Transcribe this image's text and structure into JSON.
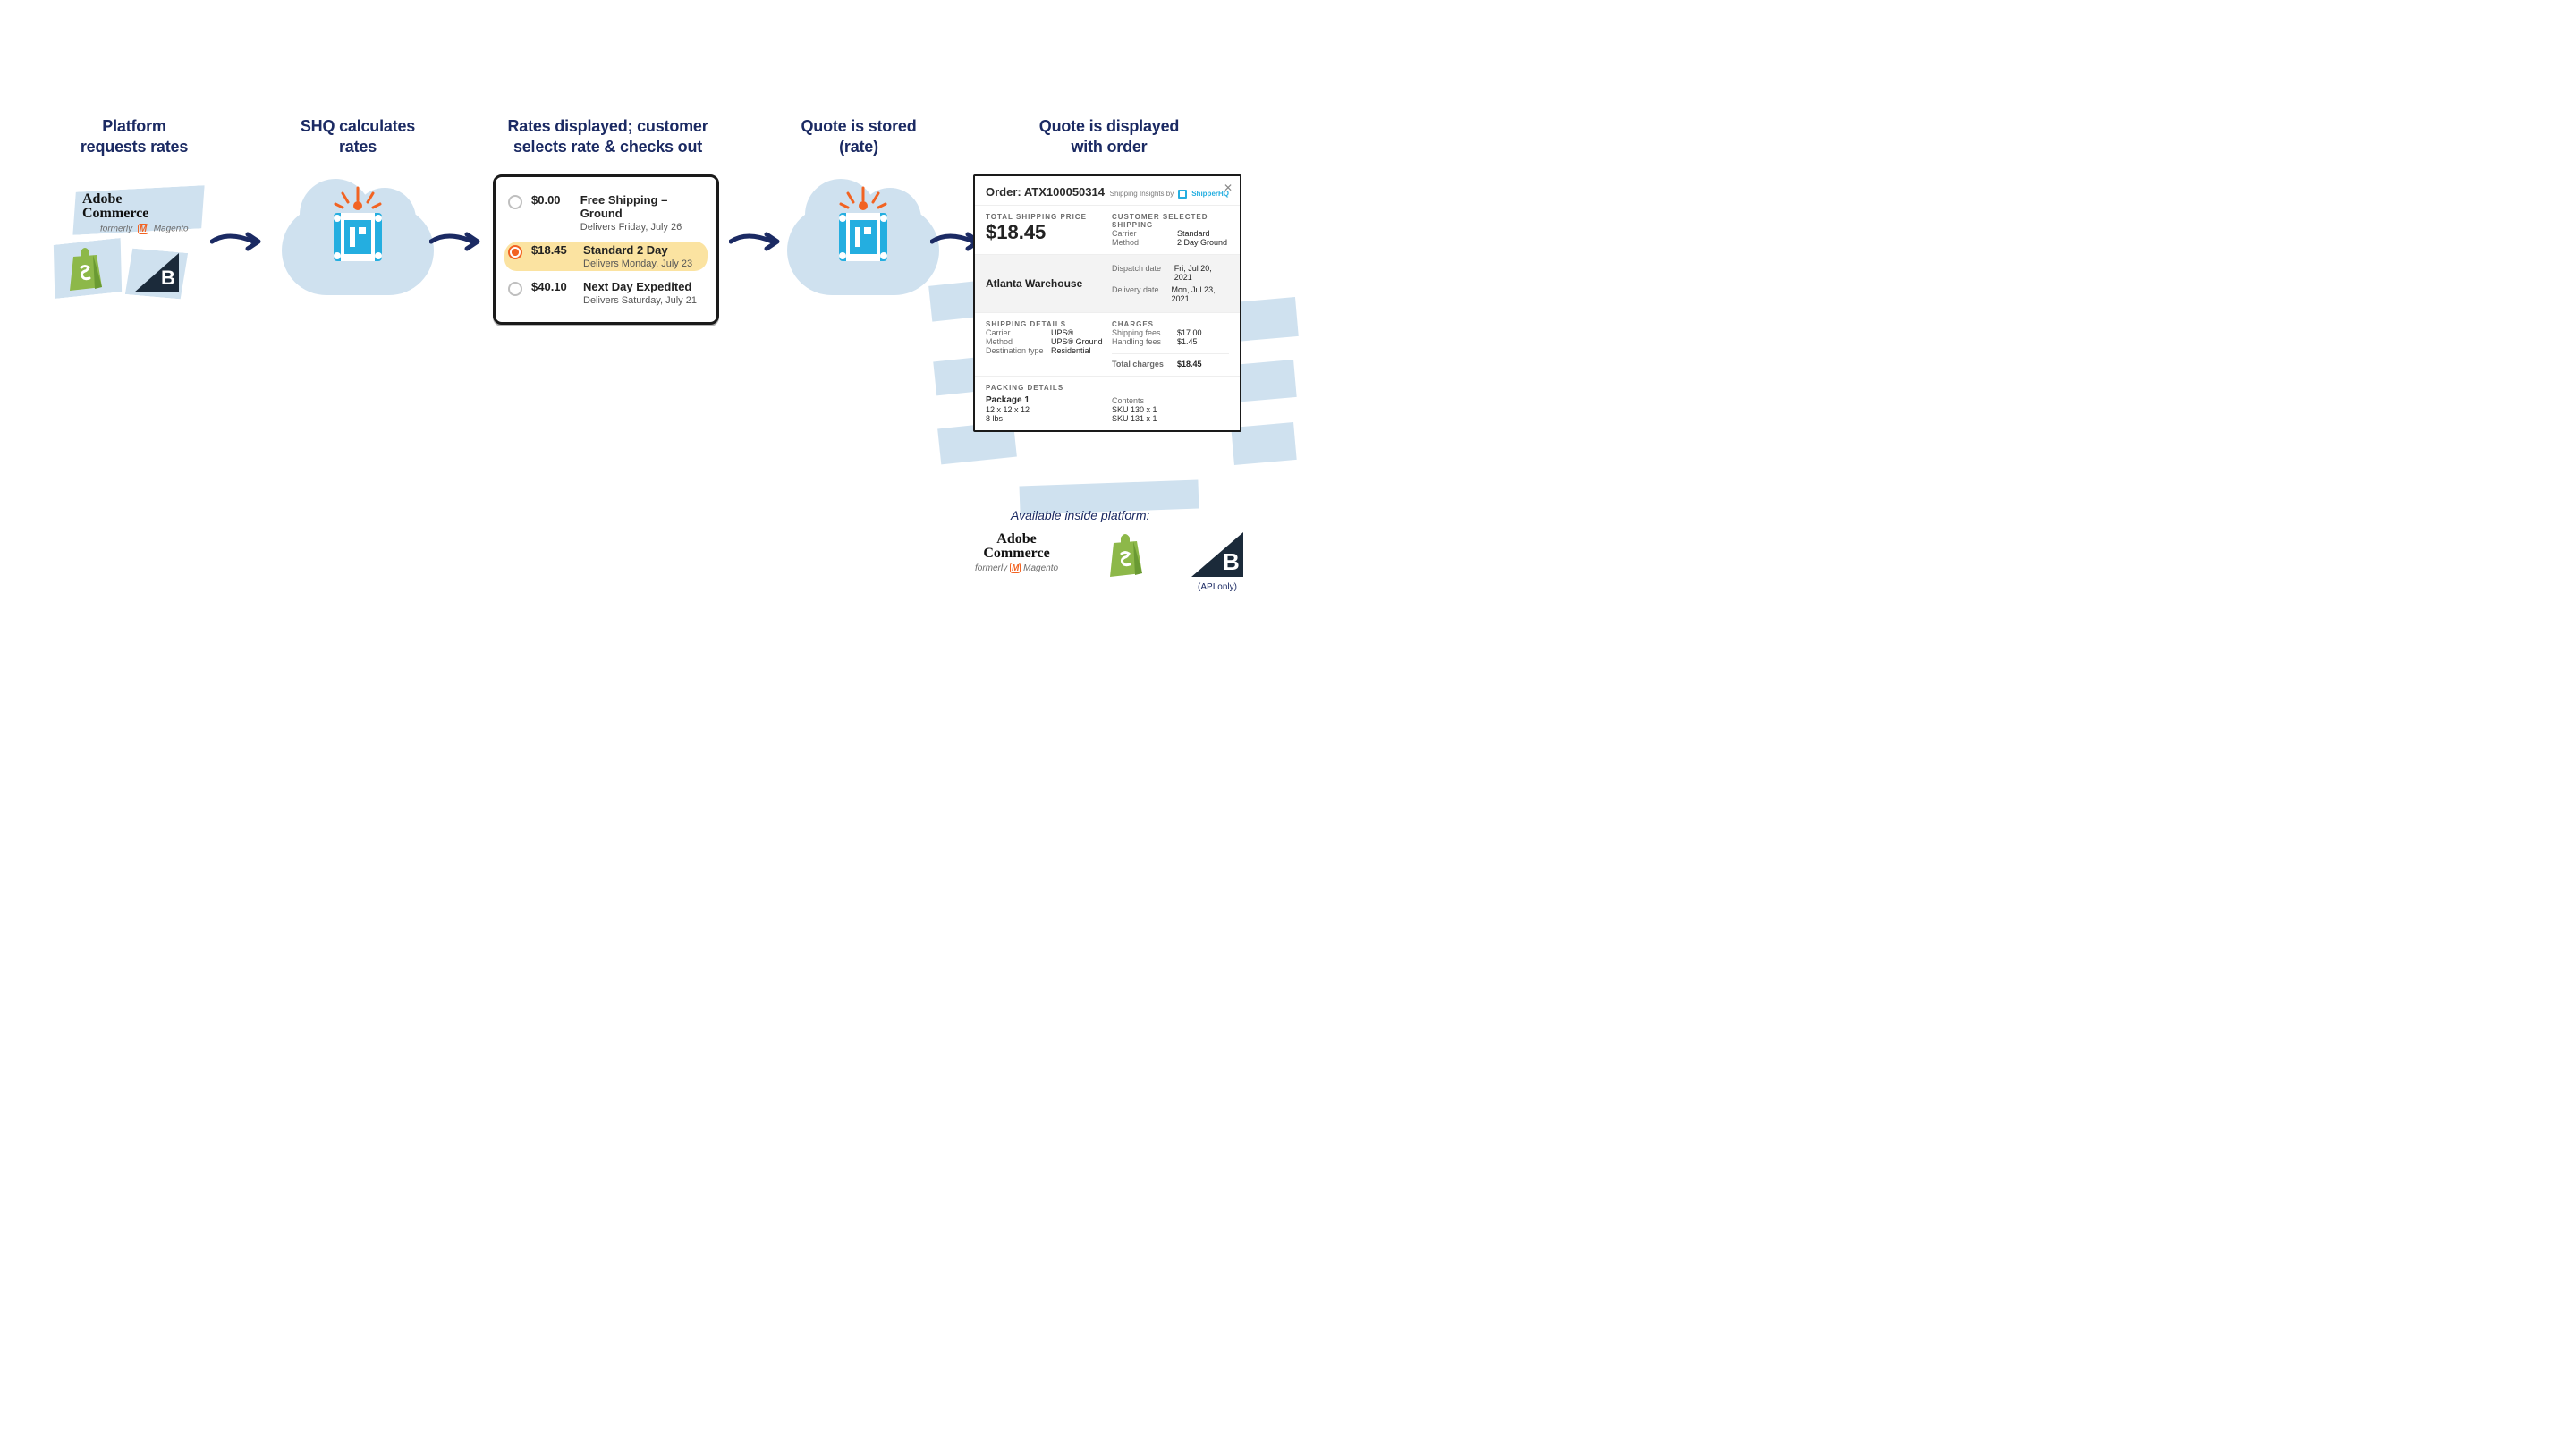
{
  "steps": {
    "s1": "Platform\nrequests rates",
    "s2": "SHQ calculates\nrates",
    "s3": "Rates displayed; customer\nselects rate & checks out",
    "s4": "Quote is stored\n(rate)",
    "s5": "Quote is displayed\nwith order"
  },
  "platforms": {
    "adobe_line1": "Adobe",
    "adobe_line2": "Commerce",
    "formerly": "formerly",
    "magento": "Magento"
  },
  "rates": [
    {
      "price": "$0.00",
      "name": "Free Shipping – Ground",
      "sub": "Delivers Friday, July 26",
      "selected": false
    },
    {
      "price": "$18.45",
      "name": "Standard 2 Day",
      "sub": "Delivers Monday, July 23",
      "selected": true
    },
    {
      "price": "$40.10",
      "name": "Next Day Expedited",
      "sub": "Delivers Saturday, July 21",
      "selected": false
    }
  ],
  "order": {
    "title": "Order: ATX100050314",
    "insights_by": "Shipping Insights by",
    "brand": "ShipperHQ",
    "total_label": "TOTAL SHIPPING PRICE",
    "total_value": "$18.45",
    "sel_label": "CUSTOMER SELECTED SHIPPING",
    "sel_carrier_k": "Carrier",
    "sel_carrier_v": "Standard",
    "sel_method_k": "Method",
    "sel_method_v": "2 Day Ground",
    "warehouse": "Atlanta Warehouse",
    "dispatch_k": "Dispatch date",
    "dispatch_v": "Fri, Jul 20, 2021",
    "delivery_k": "Delivery date",
    "delivery_v": "Mon, Jul 23, 2021",
    "ship_details_label": "SHIPPING DETAILS",
    "ship_carrier_k": "Carrier",
    "ship_carrier_v": "UPS®",
    "ship_method_k": "Method",
    "ship_method_v": "UPS® Ground",
    "ship_dest_k": "Destination type",
    "ship_dest_v": "Residential",
    "charges_label": "CHARGES",
    "charge_ship_k": "Shipping fees",
    "charge_ship_v": "$17.00",
    "charge_hand_k": "Handling fees",
    "charge_hand_v": "$1.45",
    "charge_total_k": "Total charges",
    "charge_total_v": "$18.45",
    "packing_label": "PACKING DETAILS",
    "pkg_name": "Package 1",
    "pkg_dims": "12 x 12 x 12",
    "pkg_weight": "8 lbs",
    "contents_label": "Contents",
    "sku1": "SKU 130 x 1",
    "sku2": "SKU 131 x 1"
  },
  "footer": {
    "available": "Available inside platform:",
    "api_only": "(API only)"
  }
}
